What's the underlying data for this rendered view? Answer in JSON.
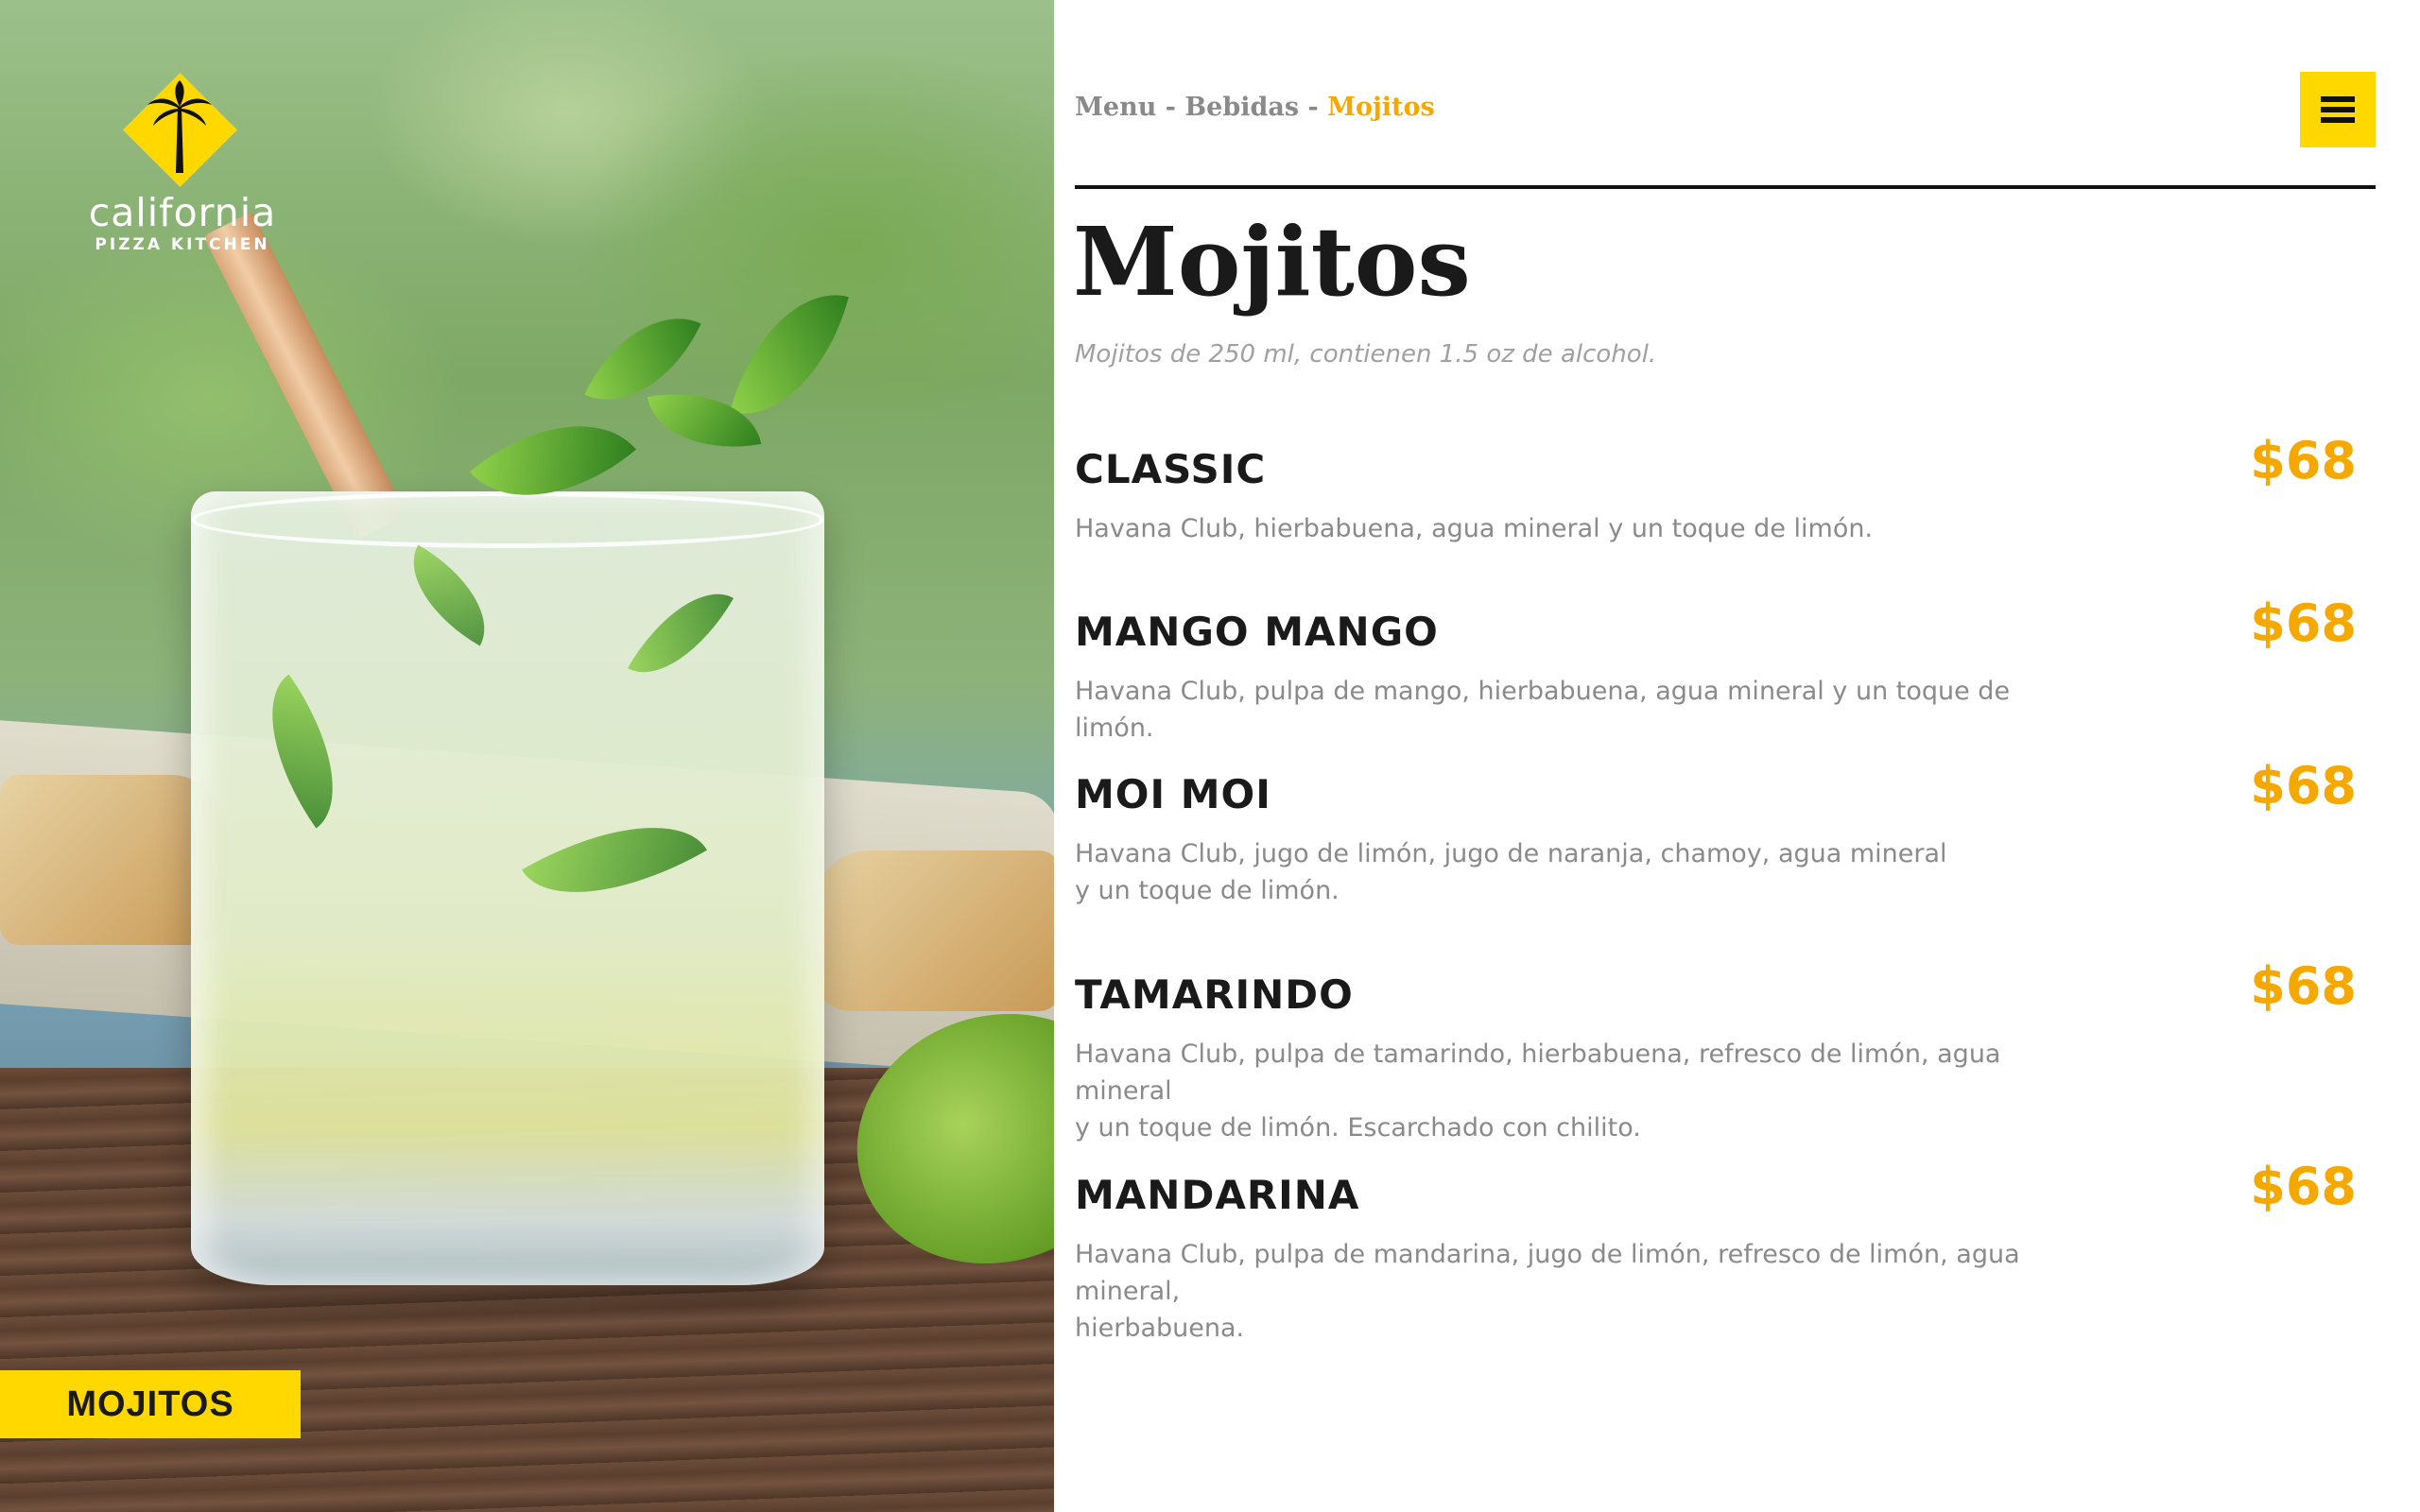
{
  "brand": {
    "name": "california",
    "subname": "PIZZA KITCHEN",
    "yellow": "#ffd800",
    "accent": "#f5a800"
  },
  "hero": {
    "section_tag": "MOJITOS"
  },
  "breadcrumb": {
    "items": [
      "Menu",
      "Bebidas"
    ],
    "separator": " - ",
    "current": "Mojitos"
  },
  "menu_button": {
    "icon": "hamburger-menu-icon"
  },
  "page": {
    "title": "Mojitos",
    "subtitle": "Mojitos de 250 ml, contienen 1.5 oz de alcohol."
  },
  "items": [
    {
      "name": "CLASSIC",
      "desc_lines": [
        "Havana Club, hierbabuena, agua mineral y un toque de limón."
      ],
      "price": "$68"
    },
    {
      "name": "MANGO MANGO",
      "desc_lines": [
        "Havana Club, pulpa de mango, hierbabuena, agua mineral y un toque de limón."
      ],
      "price": "$68"
    },
    {
      "name": "MOI MOI",
      "desc_lines": [
        "Havana Club, jugo de limón, jugo de naranja, chamoy, agua mineral",
        "y un toque de limón."
      ],
      "price": "$68"
    },
    {
      "name": "TAMARINDO",
      "desc_lines": [
        "Havana Club, pulpa de tamarindo, hierbabuena, refresco de limón, agua mineral",
        "y un toque de limón. Escarchado con chilito."
      ],
      "price": "$68"
    },
    {
      "name": "MANDARINA",
      "desc_lines": [
        "Havana Club, pulpa de mandarina, jugo de limón, refresco de limón, agua mineral,",
        "hierbabuena."
      ],
      "price": "$68"
    }
  ]
}
